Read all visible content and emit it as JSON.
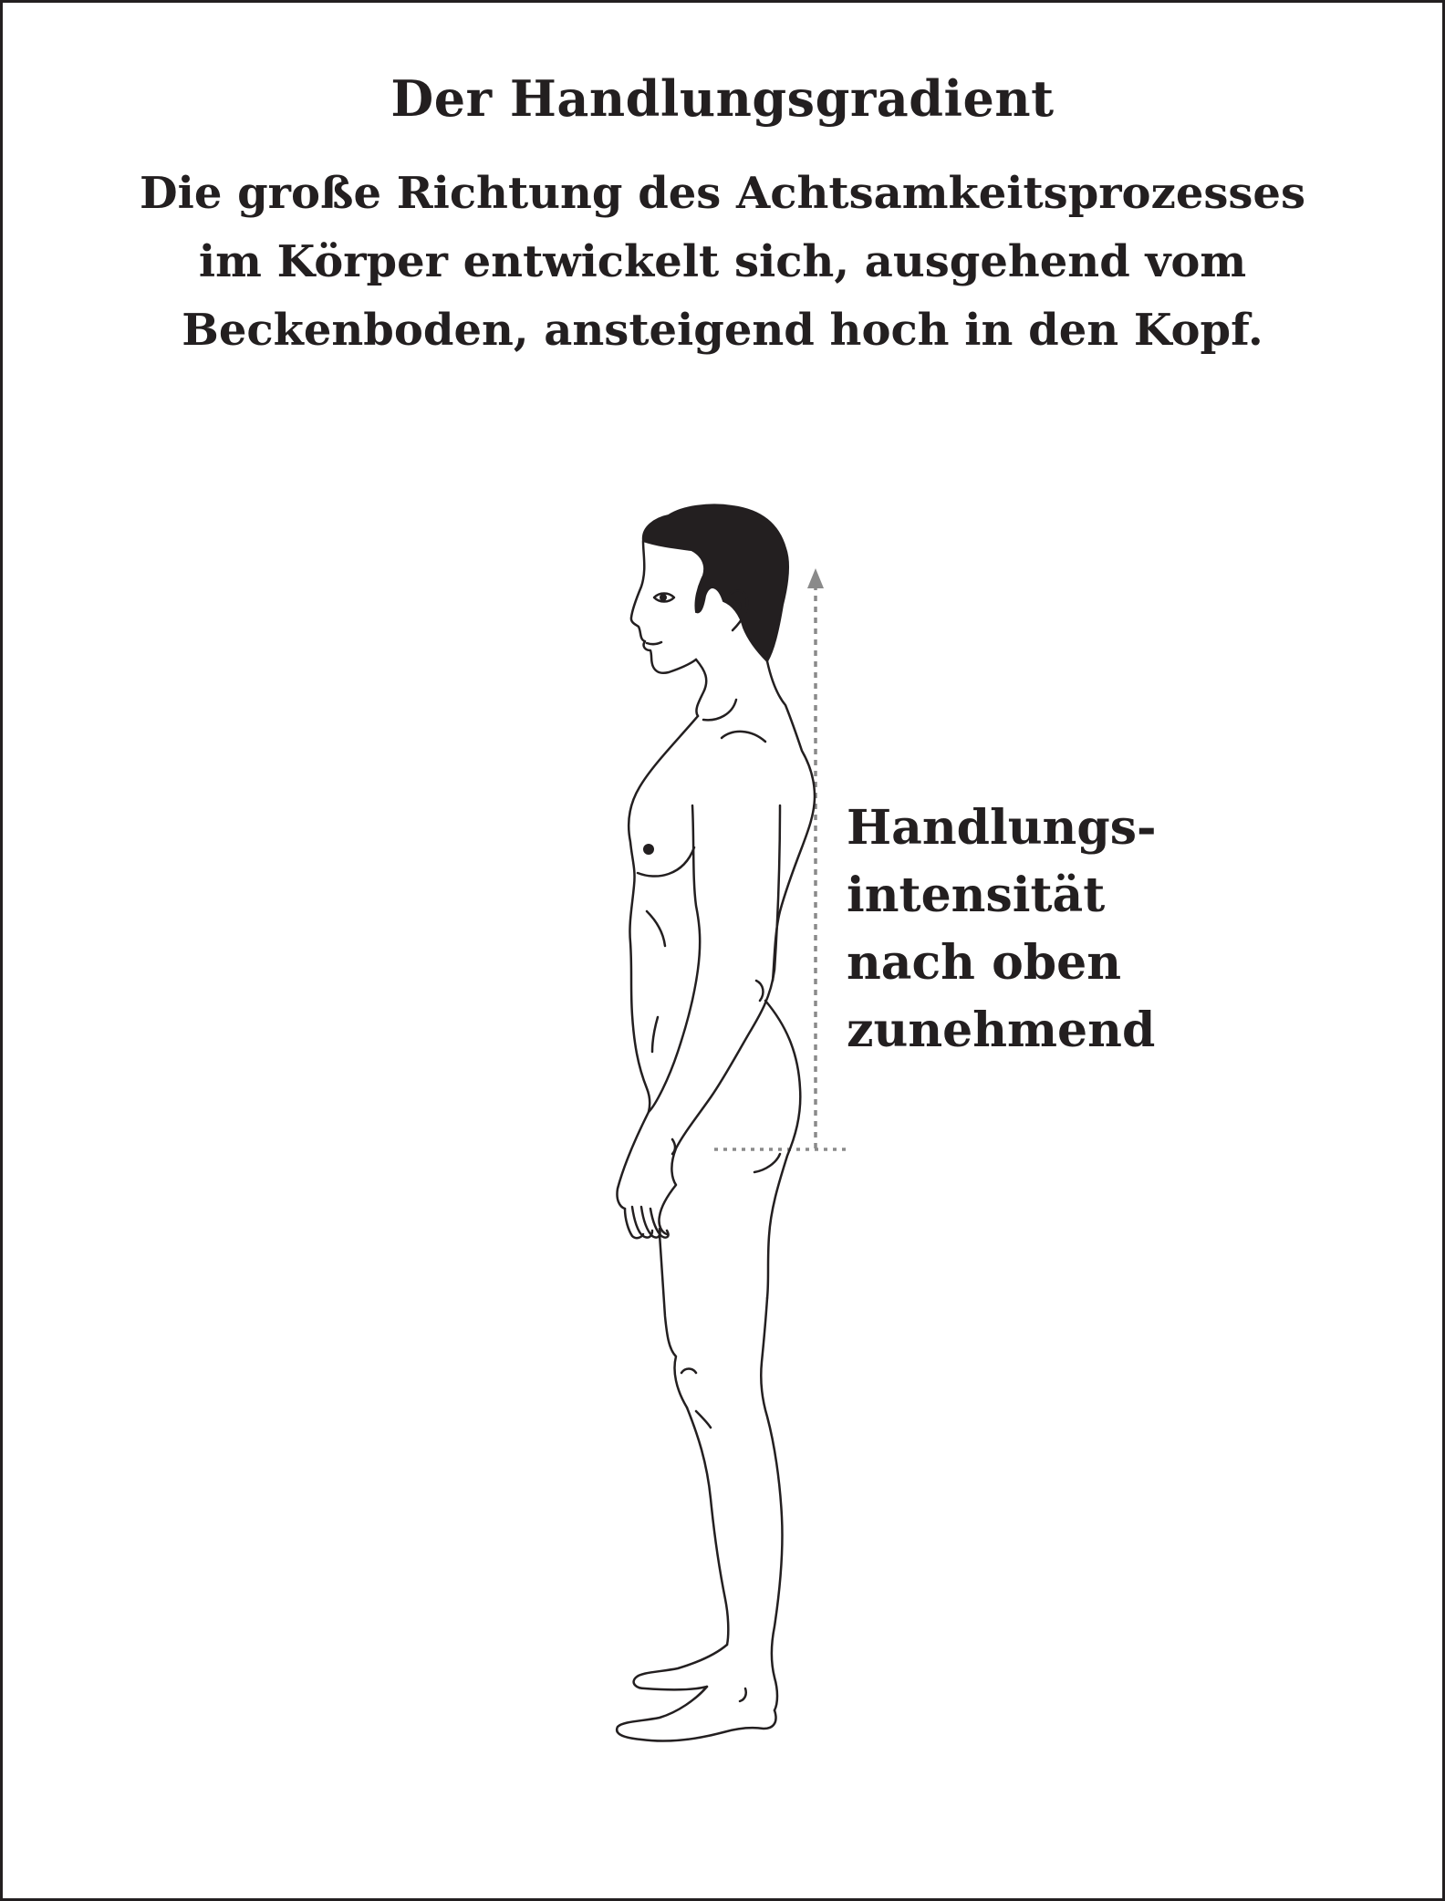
{
  "diagram": {
    "title": "Der Handlungsgradient",
    "subtitle_lines": [
      "Die große Richtung des Achtsamkeitsprozesses",
      "im Körper entwickelt sich, ausgehend vom",
      "Beckenboden, ansteigend hoch in den Kopf."
    ],
    "annotation_lines": [
      "Handlungs-",
      "intensität",
      "nach oben",
      "zunehmend"
    ],
    "figure_icon": "standing-human-profile",
    "arrow_color": "#8a8a8a",
    "line_color": "#231f20"
  }
}
